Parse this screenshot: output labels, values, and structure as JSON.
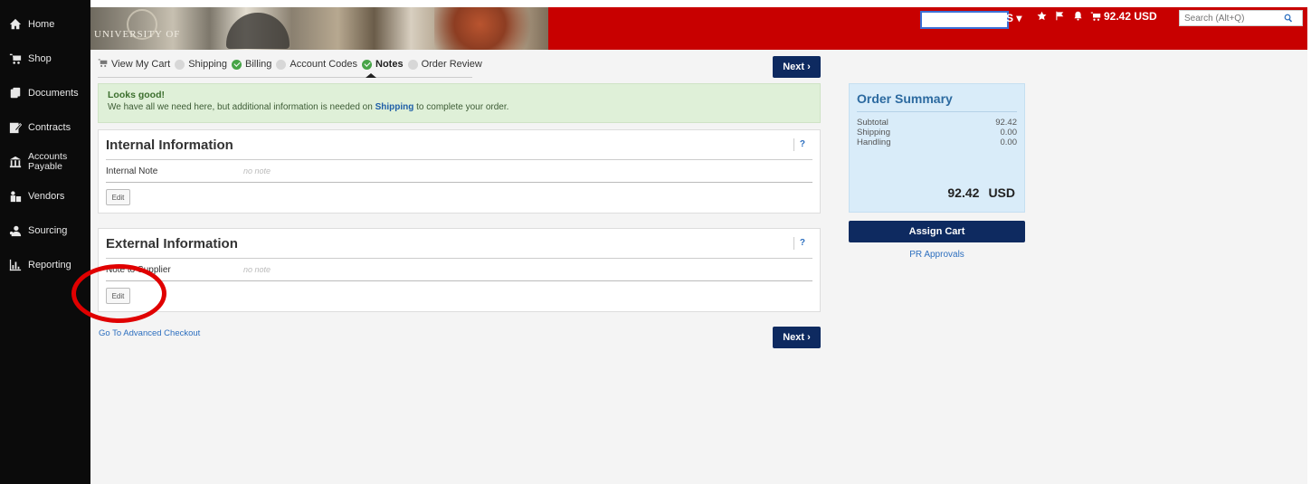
{
  "sidebar": {
    "items": [
      {
        "label": "Home",
        "icon": "home-icon"
      },
      {
        "label": "Shop",
        "icon": "cart-icon"
      },
      {
        "label": "Documents",
        "icon": "documents-icon"
      },
      {
        "label": "Contracts",
        "icon": "contracts-icon"
      },
      {
        "label": "Accounts Payable",
        "icon": "bank-icon"
      },
      {
        "label": "Vendors",
        "icon": "vendors-icon"
      },
      {
        "label": "Sourcing",
        "icon": "sourcing-icon"
      },
      {
        "label": "Reporting",
        "icon": "chart-icon"
      }
    ]
  },
  "header": {
    "banner_text": "UNIVERSITY OF",
    "chevron": "S ▾",
    "cart_total": "92.42 USD",
    "search_placeholder": "Search (Alt+Q)"
  },
  "steps": [
    {
      "label": "View My Cart",
      "status": "cart"
    },
    {
      "label": "Shipping",
      "status": "pending"
    },
    {
      "label": "Billing",
      "status": "done"
    },
    {
      "label": "Account Codes",
      "status": "pending"
    },
    {
      "label": "Notes",
      "status": "done-active"
    },
    {
      "label": "Order Review",
      "status": "pending"
    }
  ],
  "next_label": "Next",
  "alert": {
    "title": "Looks good!",
    "prefix": "We have all we need here, but additional information is needed on",
    "link": "Shipping",
    "suffix": "to complete your order."
  },
  "internal": {
    "title": "Internal Information",
    "help": "?",
    "field_label": "Internal Note",
    "field_value": "no note",
    "edit_label": "Edit"
  },
  "external": {
    "title": "External Information",
    "help": "?",
    "field_label": "Note to Supplier",
    "field_value": "no note",
    "edit_label": "Edit"
  },
  "advanced_link": "Go To Advanced Checkout",
  "summary": {
    "title": "Order Summary",
    "rows": [
      {
        "label": "Subtotal",
        "value": "92.42"
      },
      {
        "label": "Shipping",
        "value": "0.00"
      },
      {
        "label": "Handling",
        "value": "0.00"
      }
    ],
    "total": "92.42",
    "currency": "USD"
  },
  "assign_label": "Assign Cart",
  "pr_link": "PR Approvals",
  "annotation_color": "#e00000"
}
